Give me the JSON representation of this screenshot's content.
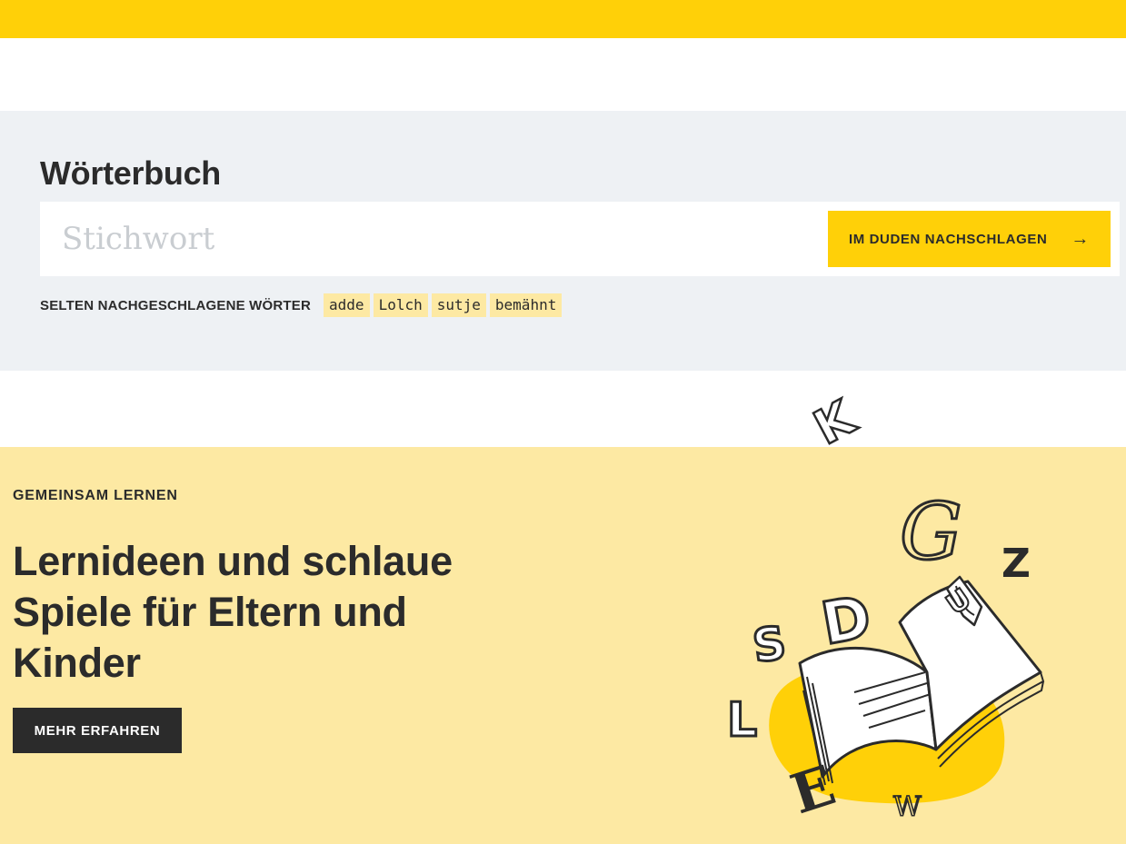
{
  "colors": {
    "brand_yellow": "#ffd008",
    "light_yellow": "#fde9a3",
    "dict_background": "#eef1f4",
    "text_dark": "#2b2b2b"
  },
  "dictionary": {
    "title": "Wörterbuch",
    "search": {
      "placeholder": "Stichwort",
      "value": "",
      "button_label": "IM DUDEN NACHSCHLAGEN",
      "button_icon": "arrow-right-icon"
    },
    "rare_words": {
      "label": "SELTEN NACHGESCHLAGENE WÖRTER",
      "words": [
        "adde",
        "Lolch",
        "sutje",
        "bemähnt"
      ]
    }
  },
  "learn_teaser": {
    "kicker": "GEMEINSAM LERNEN",
    "heading": "Lernideen und schlaue Spiele für Eltern und Kinder",
    "button_label": "MEHR ERFAHREN",
    "illustration_letters": [
      "K",
      "G",
      "Z",
      "D",
      "S",
      "U",
      "L",
      "E",
      "W"
    ]
  }
}
